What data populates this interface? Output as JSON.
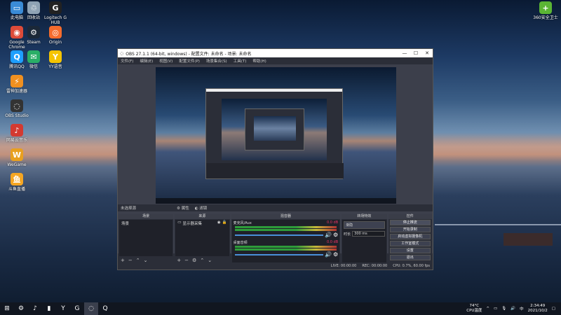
{
  "desktop_icons": [
    {
      "label": "此电脑",
      "icon": "computer-icon",
      "color": "#3a8bd6",
      "glyph": "▭"
    },
    {
      "label": "回收站",
      "icon": "recycle-bin-icon",
      "color": "#8fa3b5",
      "glyph": "♲"
    },
    {
      "label": "Logitech G\nHUB",
      "icon": "logitech-icon",
      "color": "#222",
      "glyph": "G"
    },
    {
      "label": "Google\nChrome",
      "icon": "chrome-icon",
      "color": "#dd4b39",
      "glyph": "◉"
    },
    {
      "label": "Steam",
      "icon": "steam-icon",
      "color": "#1b2838",
      "glyph": "⚙"
    },
    {
      "label": "Origin",
      "icon": "origin-icon",
      "color": "#f56c2d",
      "glyph": "◎"
    },
    {
      "label": "腾讯QQ",
      "icon": "qq-icon",
      "color": "#1e9fff",
      "glyph": "Q"
    },
    {
      "label": "微信",
      "icon": "wechat-icon",
      "color": "#2aae67",
      "glyph": "✉"
    },
    {
      "label": "YY语音",
      "icon": "yy-icon",
      "color": "#f5c400",
      "glyph": "Y"
    },
    {
      "label": "雷神加速器",
      "icon": "thunder-accelerator-icon",
      "color": "#f09020",
      "glyph": "⚡"
    },
    {
      "label": "OBS Studio",
      "icon": "obs-icon",
      "color": "#333",
      "glyph": "◌"
    },
    {
      "label": "网易云音乐",
      "icon": "netease-music-icon",
      "color": "#d33a31",
      "glyph": "♪"
    },
    {
      "label": "WeGame",
      "icon": "wegame-icon",
      "color": "#e8a020",
      "glyph": "W"
    },
    {
      "label": "斗鱼直播",
      "icon": "douyu-icon",
      "color": "#f5a623",
      "glyph": "鱼"
    }
  ],
  "right_icon": {
    "label": "360安全卫士",
    "icon": "360-icon",
    "color": "#5bb534",
    "glyph": "+"
  },
  "obs": {
    "title": "OBS 27.1.1 (64-bit, windows) - 配置文件: 未命名 - 场景: 未命名",
    "menu": [
      "文件(F)",
      "编辑(E)",
      "视图(V)",
      "配置文件(P)",
      "场景集合(S)",
      "工具(T)",
      "帮助(H)"
    ],
    "context_bar": {
      "no_source": "未选择源",
      "properties": "属性",
      "filters": "滤镜"
    },
    "docks": {
      "scenes": {
        "title": "场景",
        "items": [
          "场景"
        ]
      },
      "sources": {
        "title": "来源",
        "items": [
          "显示器采集"
        ]
      },
      "mixer": {
        "title": "混音器",
        "channels": [
          {
            "name": "麦克风/Aux",
            "level": "0.0 dB"
          },
          {
            "name": "桌面音频",
            "level": "0.0 dB"
          }
        ]
      },
      "transitions": {
        "title": "转场特效",
        "type": "渐隐",
        "duration_label": "时长",
        "duration_value": "300 ms"
      },
      "controls": {
        "title": "控件",
        "buttons": [
          "停止推流",
          "开始录制",
          "启动虚拟摄像机",
          "工作室模式",
          "设置",
          "退出"
        ]
      }
    },
    "status": {
      "live": "LIVE: 00:00:00",
      "rec": "REC: 00:00:00",
      "cpu": "CPU: 0.7%, 60.00 fps"
    }
  },
  "taskbar": {
    "items": [
      {
        "icon": "windows-start-icon",
        "glyph": "⊞"
      },
      {
        "icon": "steam-taskbar-icon",
        "glyph": "⚙"
      },
      {
        "icon": "netease-taskbar-icon",
        "glyph": "♪"
      },
      {
        "icon": "app-taskbar-icon",
        "glyph": "▮"
      },
      {
        "icon": "yy-taskbar-icon",
        "glyph": "Y"
      },
      {
        "icon": "logitech-taskbar-icon",
        "glyph": "G"
      },
      {
        "icon": "obs-taskbar-icon",
        "glyph": "◌"
      },
      {
        "icon": "qq-taskbar-icon",
        "glyph": "Q"
      }
    ],
    "weather_temp": "74°C",
    "weather_label": "CPU温度",
    "time": "2:34:49",
    "date": "2021/10/2"
  }
}
